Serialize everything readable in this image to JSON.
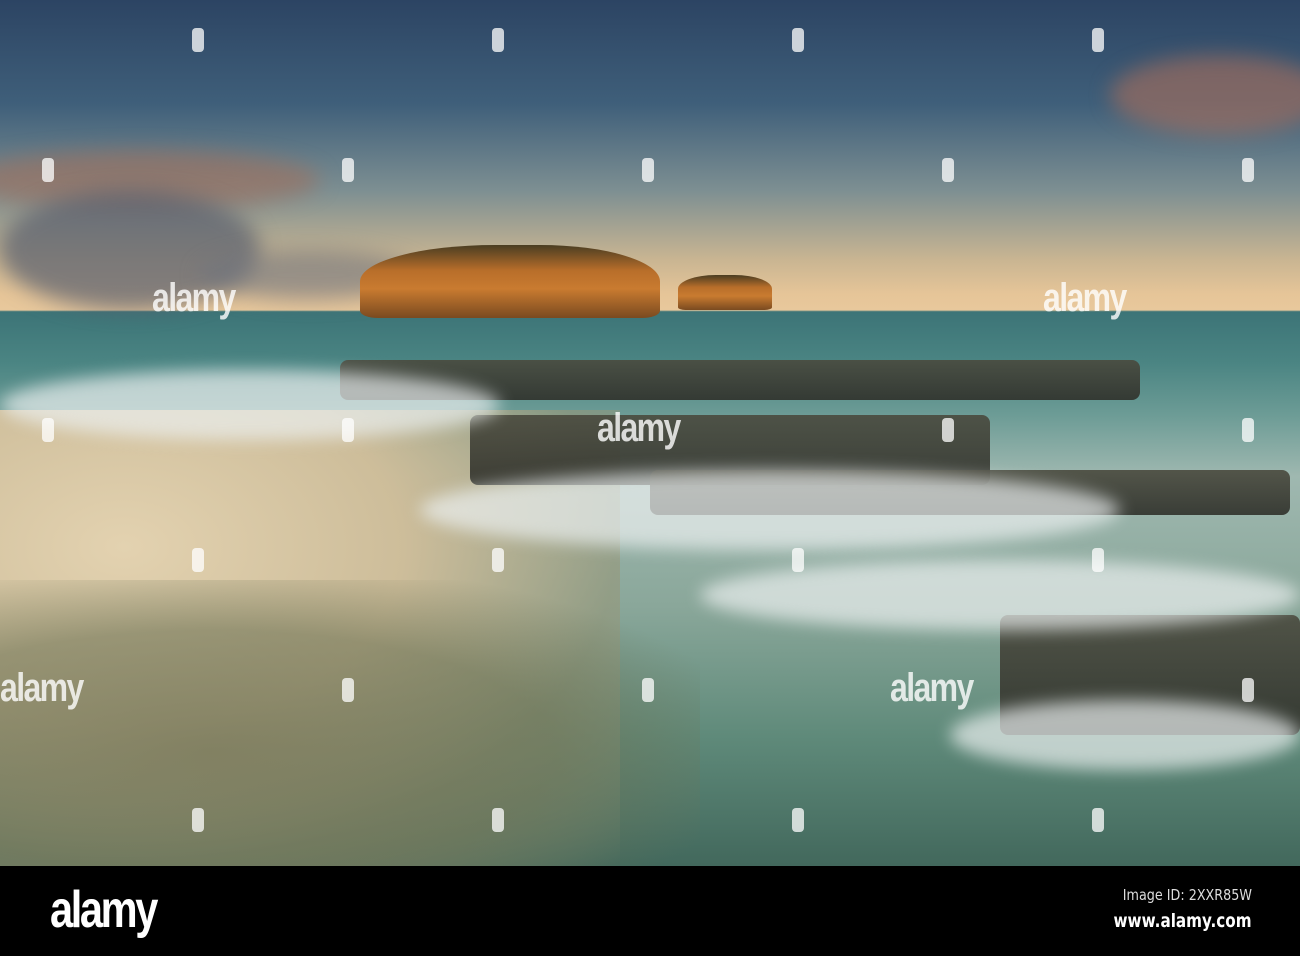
{
  "watermark": {
    "text": "alamy"
  },
  "footer": {
    "logo": "alamy",
    "image_id": "Image ID: 2XXR85W",
    "website": "www.alamy.com"
  }
}
